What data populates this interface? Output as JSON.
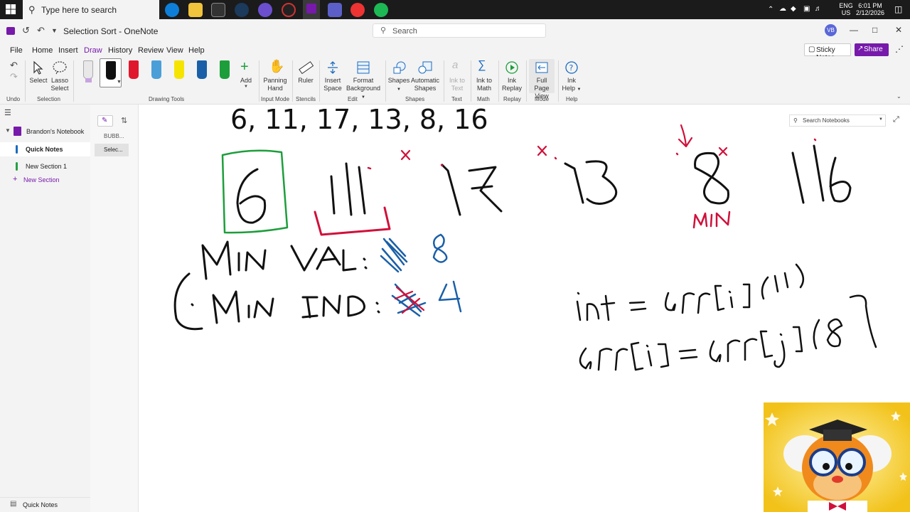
{
  "taskbar": {
    "search_placeholder": "Type here to search",
    "tray_lang": "ENG",
    "tray_region": "US",
    "time": "6:01 PM",
    "date": "2/12/2026"
  },
  "titlebar": {
    "doc_title": "Selection Sort",
    "separator": "-",
    "app_name": "OneNote",
    "search_placeholder": "Search",
    "avatar_initials": "VB"
  },
  "menu": {
    "items": [
      "File",
      "Home",
      "Insert",
      "Draw",
      "History",
      "Review",
      "View",
      "Help"
    ],
    "active": "Draw",
    "sticky_notes": "Sticky Notes",
    "share": "Share"
  },
  "ribbon": {
    "select": "Select",
    "lasso_select_1": "Lasso",
    "lasso_select_2": "Select",
    "add": "Add",
    "panning_hand_1": "Panning",
    "panning_hand_2": "Hand",
    "ruler": "Ruler",
    "insert_space_1": "Insert",
    "insert_space_2": "Space",
    "format_bg_1": "Format",
    "format_bg_2": "Background",
    "shapes": "Shapes",
    "auto_shapes_1": "Automatic",
    "auto_shapes_2": "Shapes",
    "ink_to_text_1": "Ink to",
    "ink_to_text_2": "Text",
    "ink_to_math_1": "Ink to",
    "ink_to_math_2": "Math",
    "ink_replay_1": "Ink",
    "ink_replay_2": "Replay",
    "full_page_1": "Full Page",
    "full_page_2": "View",
    "ink_help_1": "Ink",
    "ink_help_2": "Help",
    "groups": {
      "undo": "Undo",
      "selection": "Selection",
      "drawing_tools": "Drawing Tools",
      "input_mode": "Input Mode",
      "stencils": "Stencils",
      "edit": "Edit",
      "shapes": "Shapes",
      "text": "Text",
      "math": "Math",
      "replay": "Replay",
      "mode": "Mode",
      "help": "Help"
    },
    "pen_colors": [
      "#d9d9d9",
      "#111111",
      "#e0182d",
      "#4a9fd8",
      "#f5e400",
      "#1a5fa8",
      "#1d9e3b"
    ]
  },
  "notebook": {
    "name": "Brandon's Notebook",
    "sections": [
      {
        "label": "Quick Notes",
        "color": "#1a6bbf",
        "active": true
      },
      {
        "label": "New Section 1",
        "color": "#26a044",
        "active": false
      }
    ],
    "new_section": "New Section",
    "footer": "Quick Notes"
  },
  "pages": {
    "items": [
      "BUBB...",
      "Selec..."
    ],
    "active": "Selec..."
  },
  "canvas": {
    "array_text": "6, 11, 17, 13, 8, 16",
    "search_notebooks": "Search Notebooks",
    "ink_labels": [
      "6",
      "11",
      "17",
      "13",
      "8",
      "16",
      "MIN",
      "MIN VAL:",
      "MIN IND:",
      "8",
      "4",
      "int = arr[i] (11)",
      "arr[i] = arr[j] (8)"
    ]
  },
  "colors": {
    "accent": "#7719aa",
    "ink_black": "#111111",
    "ink_green": "#1d9e3b",
    "ink_red": "#d0103a",
    "ink_blue": "#1a6bbf"
  }
}
